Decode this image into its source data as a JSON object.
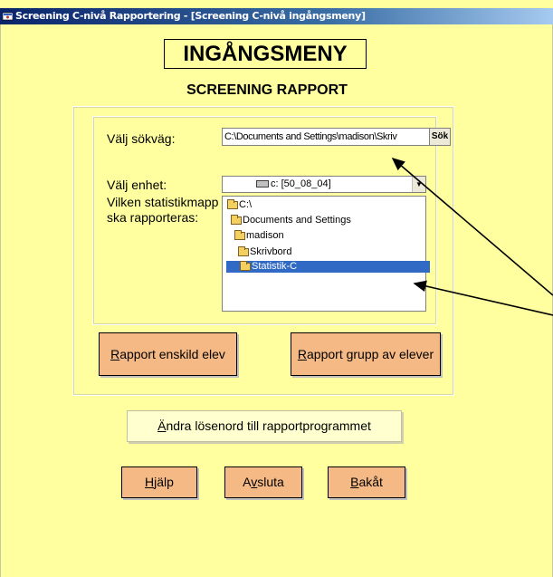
{
  "window": {
    "title": "Screening C-nivå Rapportering - [Screening C-nivå ingångsmeny]"
  },
  "header": {
    "title": "INGÅNGSMENY",
    "subtitle": "SCREENING RAPPORT"
  },
  "path_section": {
    "label": "Välj sökväg:",
    "value": "C:\\Documents and Settings\\madison\\Skriv",
    "search_button": "Sök"
  },
  "drive_section": {
    "label": "Välj enhet:",
    "selected_drive": "c: [50_08_04]"
  },
  "folder_section": {
    "label_line1": "Vilken statistikmapp",
    "label_line2": "ska rapporteras:",
    "folders": [
      {
        "name": "C:\\",
        "selected": false
      },
      {
        "name": "Documents and Settings",
        "selected": false
      },
      {
        "name": "madison",
        "selected": false
      },
      {
        "name": "Skrivbord",
        "selected": false
      },
      {
        "name": "Statistik-C",
        "selected": true
      }
    ]
  },
  "buttons": {
    "report_single": {
      "hotkey": "R",
      "rest": "apport enskild elev"
    },
    "report_group": {
      "hotkey": "R",
      "rest": "apport grupp av elever"
    },
    "change_password": {
      "hotkey": "Ä",
      "rest": "ndra lösenord till rapportprogrammet"
    },
    "help": {
      "hotkey": "H",
      "rest": "jälp"
    },
    "exit": {
      "before": "A",
      "hotkey": "v",
      "rest": "sluta"
    },
    "back": {
      "hotkey": "B",
      "rest": "akåt"
    }
  },
  "colors": {
    "background": "#ffffa0",
    "button": "#f5b985",
    "selection": "#316ac5"
  }
}
